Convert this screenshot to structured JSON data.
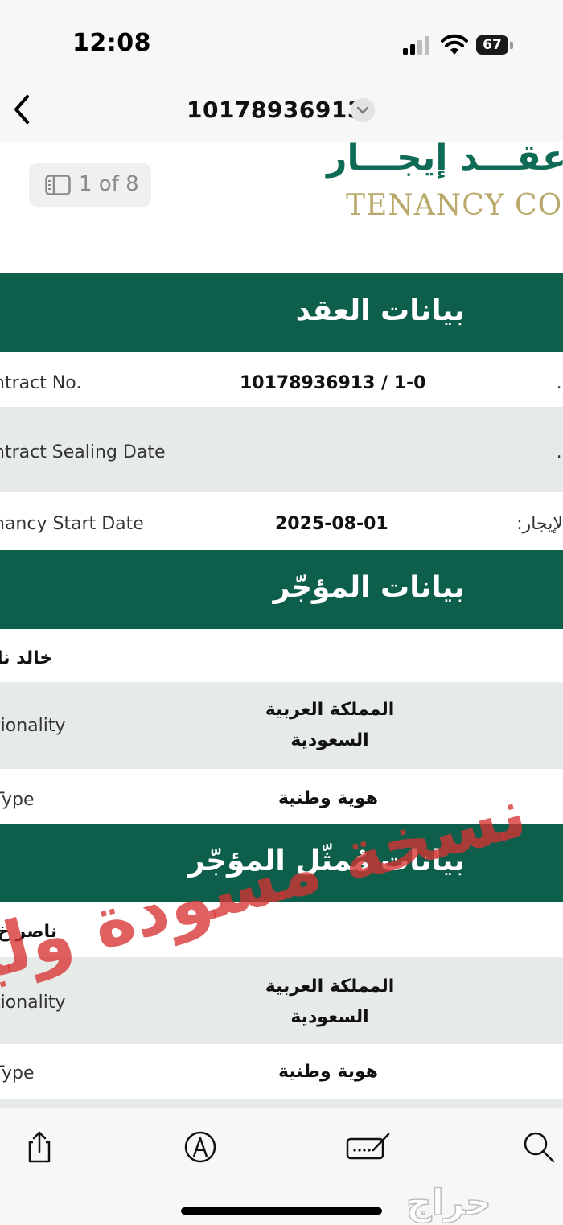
{
  "status_bar": {
    "time": "12:08",
    "battery": "67"
  },
  "nav": {
    "title": "10178936913"
  },
  "document": {
    "logo_ar": "عقـــد إيجـــار",
    "logo_en": "TENANCY CON",
    "page_indicator": "1 of 8",
    "sections": {
      "contract": {
        "title": "بيانات العقد",
        "contract_no_label": "ntract No.",
        "contract_no_value": "10178936913 / 1-0",
        "contract_no_ar": ":.",
        "sealing_label": "ntract Sealing Date",
        "sealing_ar": ":.",
        "start_label": "nancy Start Date",
        "start_value": "2025-08-01",
        "start_ar": "الإيجار:"
      },
      "lessor": {
        "title": "بيانات المؤجّر",
        "name": "خالد نا",
        "nationality_label": "tionality",
        "nationality_value_1": "المملكة العربية",
        "nationality_value_2": "السعودية",
        "id_type_label": "Type",
        "id_type_value": "هوية وطنية"
      },
      "lessor_rep": {
        "title": "بيانات مُمثّل المؤجّر",
        "name": "ناصر خ",
        "nationality_label": "tionality",
        "nationality_value_1": "المملكة العربية",
        "nationality_value_2": "السعودية",
        "id_type_label": "Type",
        "id_type_value": "هوية وطنية"
      }
    },
    "watermark": "نسخة مسودة وليـ"
  },
  "toolbar": {
    "share_icon": "share-icon",
    "markup_icon": "markup-pen-icon",
    "signature_icon": "signature-icon",
    "search_icon": "search-icon",
    "brand_watermark": "حراج"
  },
  "colors": {
    "header_green": "#0d5f4c",
    "logo_green": "#0f6b55",
    "logo_gold": "#b9a86a",
    "row_gray": "#e6ebe7",
    "watermark_red": "#d73232"
  }
}
